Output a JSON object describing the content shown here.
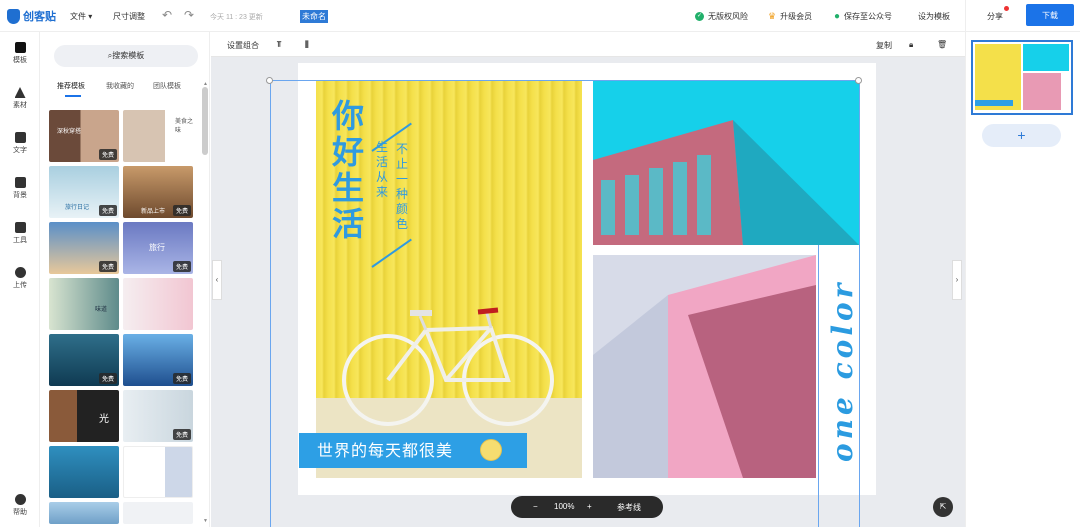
{
  "app": {
    "logo_text": "创客贴"
  },
  "topbar": {
    "file_menu": "文件",
    "resize": "尺寸调整",
    "save_time": "今天 11 : 23 更新",
    "doc_name": "未命名",
    "no_copyright_risk": "无版权风险",
    "upgrade": "升级会员",
    "save_wechat": "保存至公众号",
    "set_template": "设为模板",
    "share": "分享",
    "download": "下载"
  },
  "rail": {
    "items": [
      {
        "label": "模板",
        "icon": "template-icon"
      },
      {
        "label": "素材",
        "icon": "shapes-icon"
      },
      {
        "label": "文字",
        "icon": "text-icon"
      },
      {
        "label": "背景",
        "icon": "background-icon"
      },
      {
        "label": "工具",
        "icon": "tools-icon"
      },
      {
        "label": "上传",
        "icon": "upload-icon"
      }
    ],
    "help": "帮助"
  },
  "panel": {
    "search_placeholder": "搜索模板",
    "tabs": [
      "推荐模板",
      "我收藏的",
      "团队模板"
    ],
    "free_label": "免费",
    "thumb_texts": [
      "深秋穿搭",
      "美食之味",
      "旅行日记",
      "新品上市",
      "旅行",
      "味道",
      "光"
    ]
  },
  "canvas_toolbar": {
    "set_group": "设置组合",
    "copy": "复制"
  },
  "design": {
    "title_vertical": "你好生活",
    "sub1": "生活从来",
    "sub2": "不止一种颜色",
    "banner": "世界的每天都很美",
    "script_text": "one color"
  },
  "zoom": {
    "minus": "−",
    "level": "100%",
    "plus": "+",
    "guides": "参考线"
  },
  "right": {
    "add_page": "+"
  },
  "colors": {
    "accent": "#1b73e8",
    "design_blue": "#2f9ae0",
    "yellow": "#f4e04a",
    "cyan": "#16d0ea",
    "pink": "#e89ab4"
  }
}
